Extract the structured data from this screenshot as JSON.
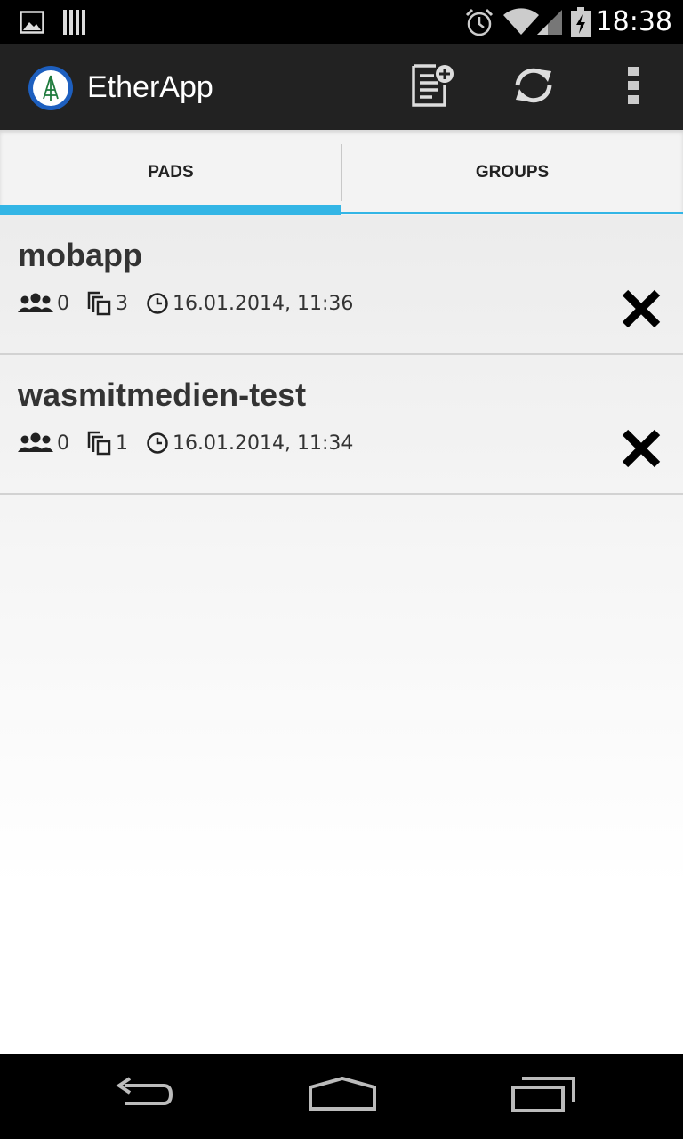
{
  "status_bar": {
    "time": "18:38",
    "icons": [
      "image-notification-icon",
      "barcode-notification-icon",
      "alarm-icon",
      "wifi-icon",
      "cell-signal-icon",
      "battery-charging-icon"
    ]
  },
  "action_bar": {
    "title": "EtherApp",
    "actions": [
      "new-pad-icon",
      "refresh-icon",
      "overflow-menu-icon"
    ]
  },
  "tabs": [
    {
      "label": "PADS",
      "selected": true
    },
    {
      "label": "GROUPS",
      "selected": false
    }
  ],
  "pads": [
    {
      "name": "mobapp",
      "users": "0",
      "revisions": "3",
      "last_edited": "16.01.2014, 11:36"
    },
    {
      "name": "wasmitmedien-test",
      "users": "0",
      "revisions": "1",
      "last_edited": "16.01.2014, 11:34"
    }
  ],
  "nav_bar": [
    "back-icon",
    "home-icon",
    "recent-apps-icon"
  ]
}
